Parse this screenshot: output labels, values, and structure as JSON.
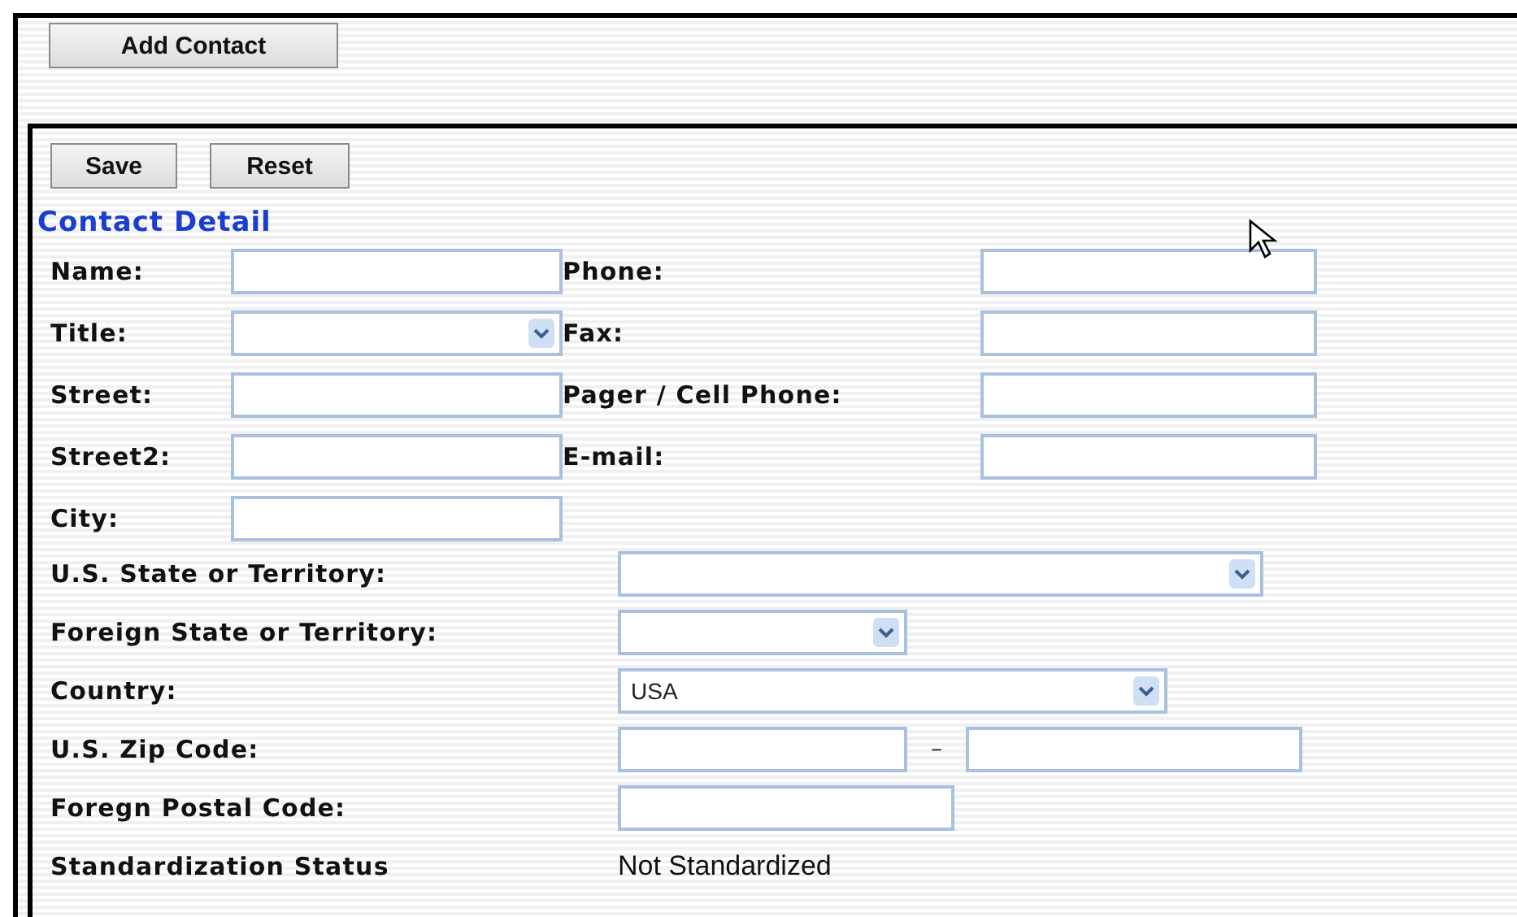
{
  "toolbar": {
    "buttons": [
      "Add Contact"
    ]
  },
  "form": {
    "buttons": [
      "Save",
      "Reset"
    ],
    "section_title": "Contact Detail",
    "left_fields": [
      {
        "label": "Name:",
        "kind": "text"
      },
      {
        "label": "Title:",
        "kind": "select"
      },
      {
        "label": "Street:",
        "kind": "text"
      },
      {
        "label": "Street2:",
        "kind": "text"
      },
      {
        "label": "City:",
        "kind": "text"
      }
    ],
    "right_fields": [
      {
        "label": "Phone:",
        "kind": "text"
      },
      {
        "label": "Fax:",
        "kind": "text"
      },
      {
        "label": "Pager / Cell Phone:",
        "kind": "text"
      },
      {
        "label": "E-mail:",
        "kind": "text"
      }
    ],
    "address_fields": [
      {
        "label": "U.S. State or Territory:",
        "kind": "select"
      },
      {
        "label": "Foreign State or Territory:",
        "kind": "select"
      },
      {
        "label": "Country:",
        "kind": "select",
        "value": "USA"
      },
      {
        "label": "U.S. Zip Code:",
        "kind": "zip",
        "separator": "–"
      },
      {
        "label": "Foregn Postal Code:",
        "kind": "text"
      },
      {
        "label": "Standardization Status",
        "kind": "status",
        "value": "Not Standardized"
      }
    ]
  }
}
